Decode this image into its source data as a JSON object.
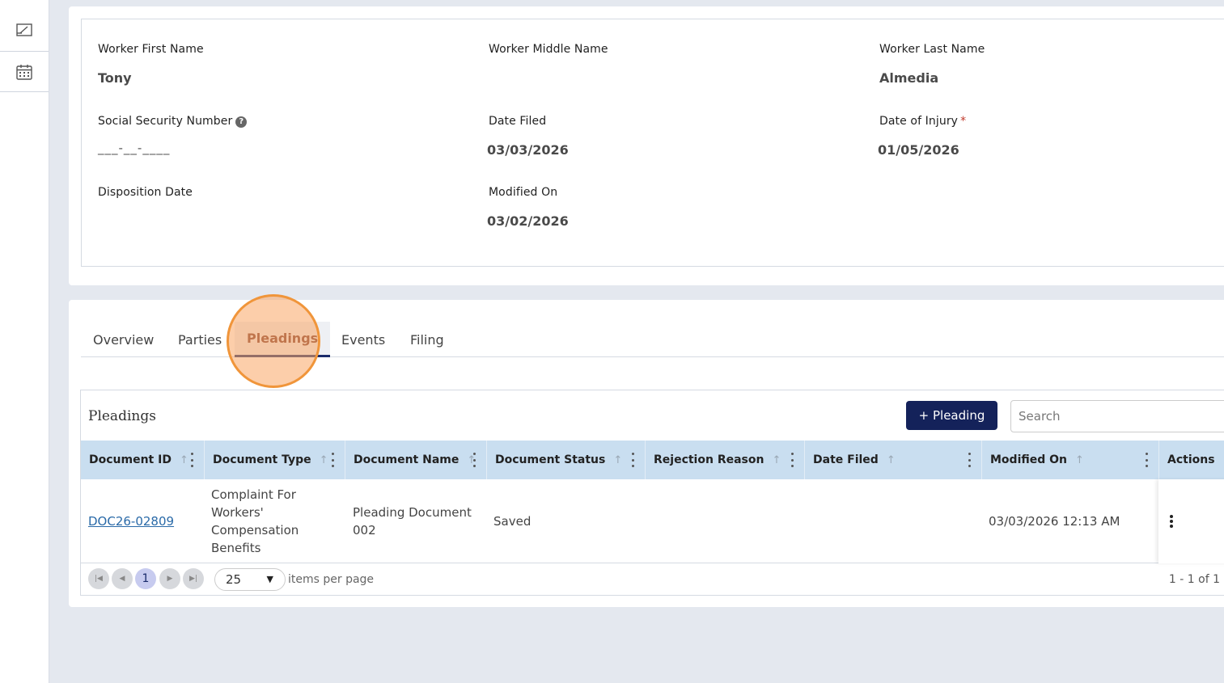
{
  "rail": {
    "items": [
      {
        "icon": "edit-note-icon"
      },
      {
        "icon": "calendar-icon"
      }
    ]
  },
  "details": {
    "worker_first_name": {
      "label": "Worker First Name",
      "value": "Tony"
    },
    "worker_middle_name": {
      "label": "Worker Middle Name",
      "value": ""
    },
    "worker_last_name": {
      "label": "Worker Last Name",
      "value": "Almedia"
    },
    "ssn": {
      "label": "Social Security Number",
      "value": "___-__-____"
    },
    "date_filed": {
      "label": "Date Filed",
      "value": "03/03/2026"
    },
    "date_of_injury": {
      "label": "Date of Injury",
      "required_mark": "*",
      "value": "01/05/2026"
    },
    "disposition_date": {
      "label": "Disposition Date",
      "value": ""
    },
    "modified_on": {
      "label": "Modified On",
      "value": "03/02/2026"
    }
  },
  "tabs": [
    {
      "label": "Overview"
    },
    {
      "label": "Parties"
    },
    {
      "label": "Pleadings",
      "active": true
    },
    {
      "label": "Events"
    },
    {
      "label": "Filing"
    }
  ],
  "grid": {
    "title": "Pleadings",
    "add_button": "+ Pleading",
    "search_placeholder": "Search",
    "columns": [
      {
        "label": "Document ID"
      },
      {
        "label": "Document Type"
      },
      {
        "label": "Document Name"
      },
      {
        "label": "Document Status"
      },
      {
        "label": "Rejection Reason"
      },
      {
        "label": "Date Filed"
      },
      {
        "label": "Modified On"
      },
      {
        "label": "Actions"
      }
    ],
    "rows": [
      {
        "document_id": "DOC26-02809",
        "document_type": "Complaint For Workers' Compensation Benefits",
        "document_name": "Pleading Document 002",
        "document_status": "Saved",
        "rejection_reason": "",
        "date_filed": "",
        "modified_on": "03/03/2026 12:13 AM"
      }
    ],
    "pager": {
      "current_page": "1",
      "page_size": "25",
      "per_page_label": "items per page",
      "range": "1 - 1 of 1"
    }
  },
  "colors": {
    "primary_button": "#14225a",
    "header_bg": "#c9def0",
    "highlight": "#f0953a",
    "link": "#2a6aa8"
  }
}
